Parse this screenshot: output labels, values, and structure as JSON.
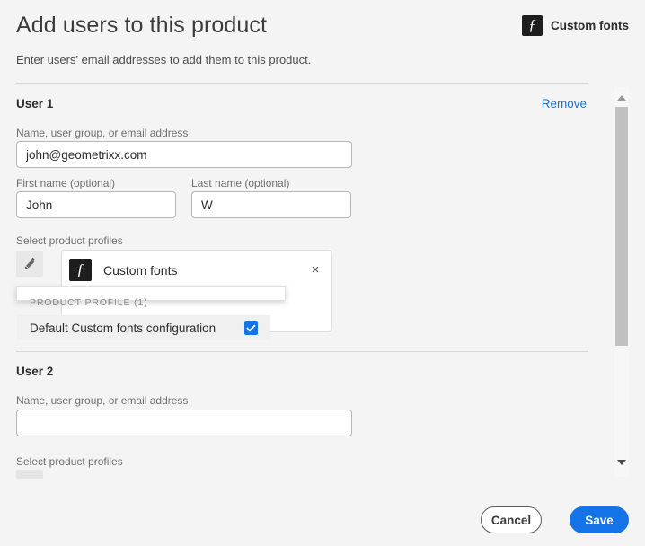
{
  "header": {
    "title": "Add users to this product",
    "subtitle": "Enter users' email addresses to add them to this product.",
    "product_badge_label": "Custom fonts",
    "product_icon_glyph": "ƒ"
  },
  "users": [
    {
      "section_title": "User 1",
      "remove_label": "Remove",
      "email_label": "Name, user group, or email address",
      "email_value": "john@geometrixx.com",
      "first_name_label": "First name (optional)",
      "first_name_value": "John",
      "last_name_label": "Last name (optional)",
      "last_name_value": "W",
      "profiles_label": "Select product profiles",
      "profile_card_title": "Custom fonts",
      "profile_card_icon_glyph": "ƒ",
      "profile_card_close": "×"
    },
    {
      "section_title": "User 2",
      "email_label": "Name, user group, or email address",
      "email_value": "",
      "email_placeholder": "",
      "profiles_label": "Select product profiles"
    }
  ],
  "dropdown": {
    "heading": "PRODUCT PROFILE (1)",
    "options": [
      {
        "label": "Default Custom fonts configuration",
        "checked": true
      }
    ]
  },
  "footer": {
    "cancel_label": "Cancel",
    "save_label": "Save"
  },
  "colors": {
    "accent_blue": "#1473E6",
    "page_bg": "#F4F4F4",
    "text_primary": "#2C2C2C",
    "text_secondary": "#6E6E6E",
    "icon_dark": "#1D1D1D"
  }
}
